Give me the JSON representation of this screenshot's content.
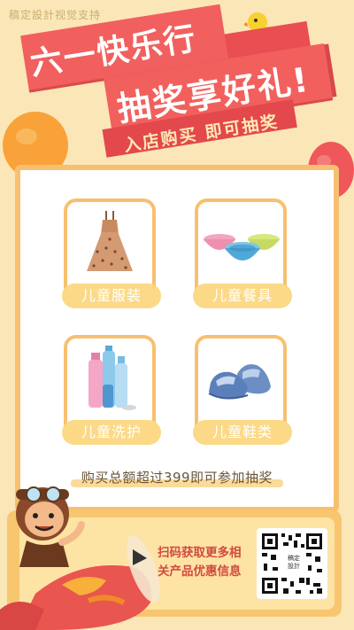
{
  "watermark": "稿定設計视觉支持",
  "title": {
    "line1": "六一快乐行",
    "line2": "抽奖享好礼!",
    "line3": "入店购买 即可抽奖"
  },
  "products": [
    {
      "label": "儿童服装",
      "icon": "dress-image"
    },
    {
      "label": "儿童餐具",
      "icon": "bowls-image"
    },
    {
      "label": "儿童洗护",
      "icon": "bottles-image"
    },
    {
      "label": "儿童鞋类",
      "icon": "shoes-image"
    }
  ],
  "note": "购买总额超过399即可参加抽奖",
  "scan": {
    "line1": "扫码获取更多相",
    "line2": "关产品优惠信息"
  },
  "qr_center": "稿定\n設計",
  "colors": {
    "background": "#fbe6b8",
    "ribbon": "#f1605e",
    "card_border": "#f7c070",
    "label_bg": "#fbd987",
    "scan_text": "#d14a40"
  }
}
